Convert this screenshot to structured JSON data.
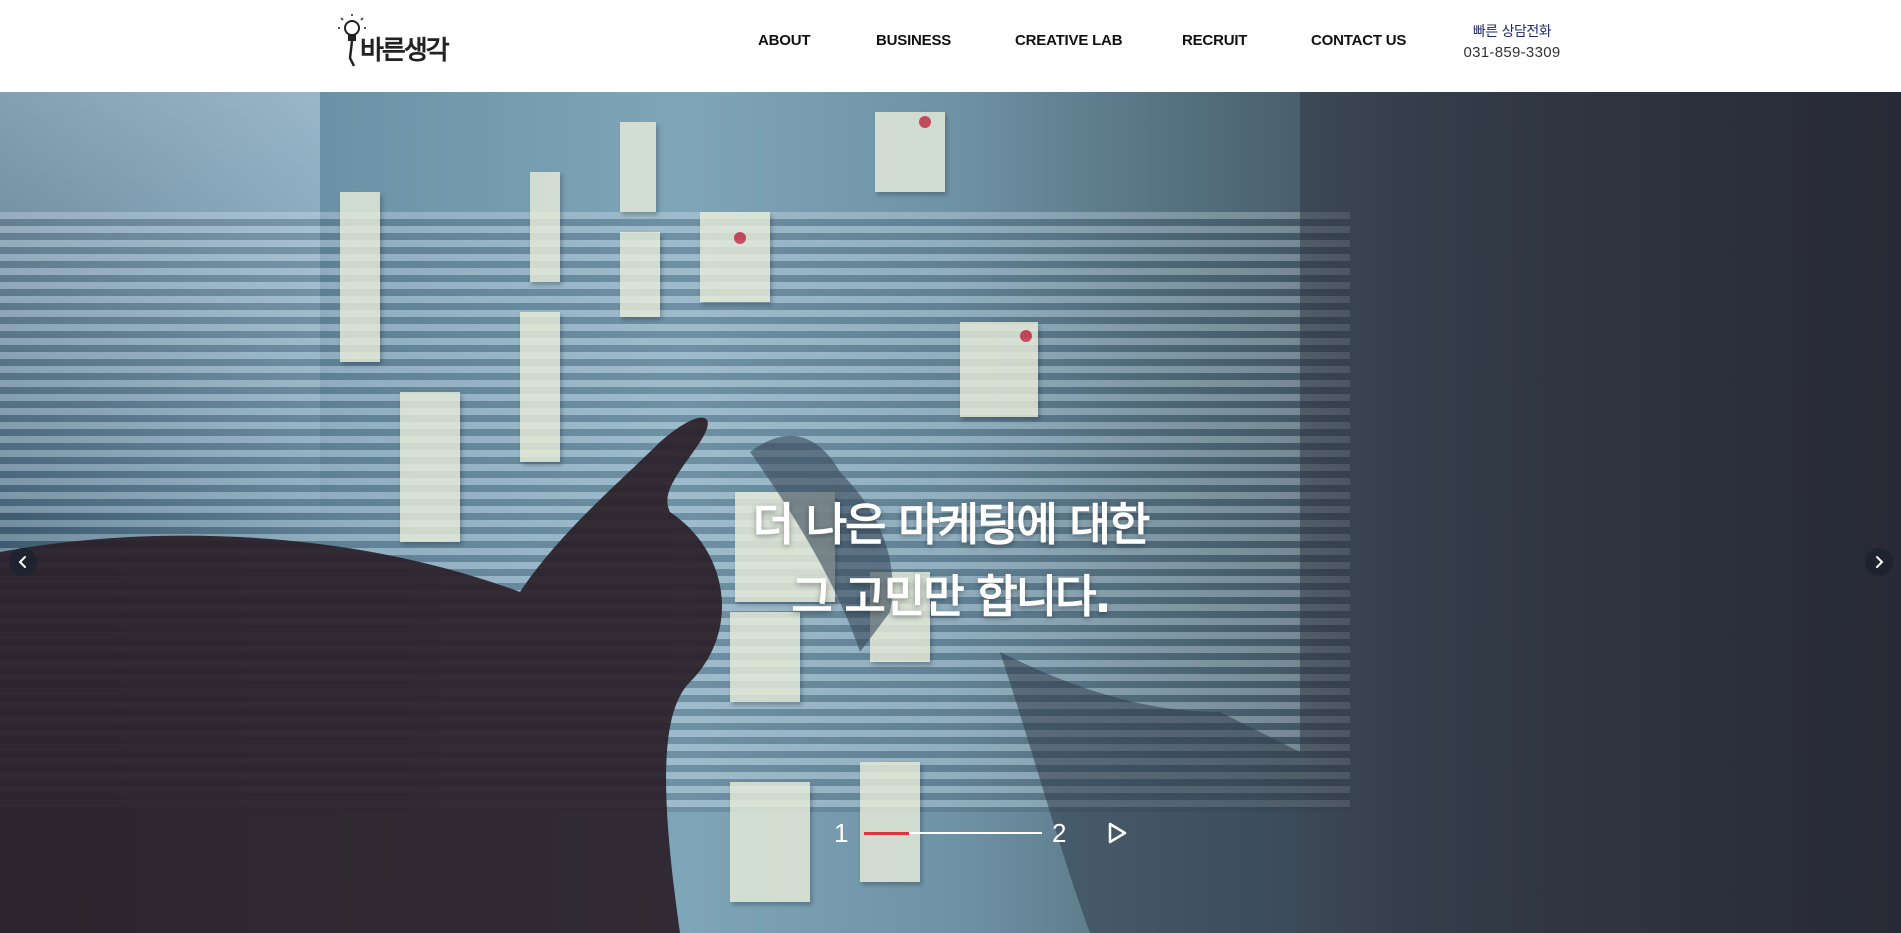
{
  "header": {
    "logo_text": "바른생각",
    "nav": [
      {
        "label": "ABOUT"
      },
      {
        "label": "BUSINESS"
      },
      {
        "label": "CREATIVE LAB"
      },
      {
        "label": "RECRUIT"
      },
      {
        "label": "CONTACT US"
      }
    ],
    "hotline": {
      "label": "빠른 상담전화",
      "number": "031-859-3309"
    }
  },
  "hero": {
    "headline_line1": "더 나은 마케팅에 대한",
    "headline_line2": "그 고민만 합니다.",
    "slider": {
      "current": "1",
      "total": "2",
      "progress": 0.25
    },
    "prev_icon": "chevron-left-icon",
    "next_icon": "chevron-right-icon",
    "play_icon": "play-icon"
  },
  "colors": {
    "accent": "#e0333f",
    "nav_text": "#111111",
    "hotline_label": "#1f2a6b"
  }
}
